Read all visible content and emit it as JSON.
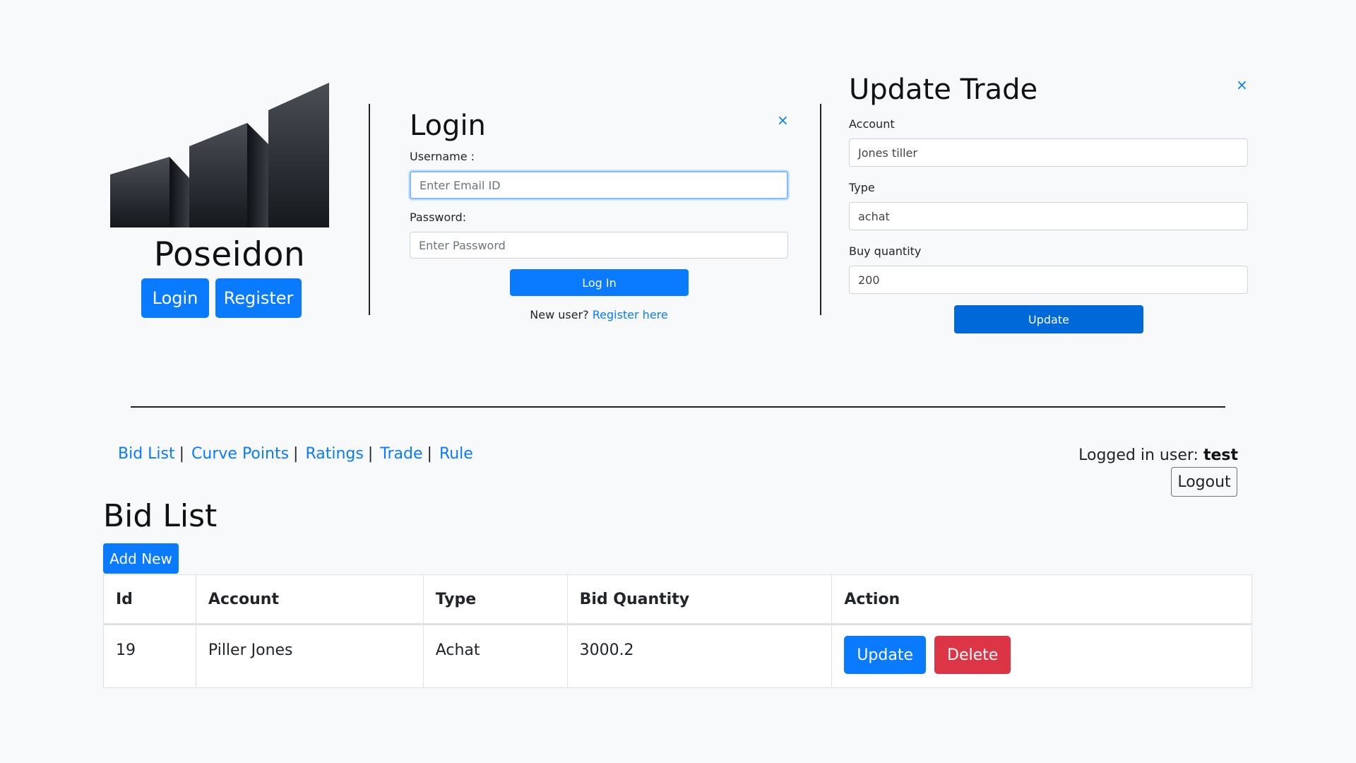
{
  "brand": {
    "name": "Poseidon",
    "login_label": "Login",
    "register_label": "Register"
  },
  "login_form": {
    "title": "Login",
    "close": "×",
    "username_label": "Username :",
    "username_placeholder": "Enter Email ID",
    "password_label": "Password:",
    "password_placeholder": "Enter Password",
    "submit_label": "Log In",
    "new_user_text": "New user?",
    "register_link": "Register here"
  },
  "update_trade": {
    "title": "Update Trade",
    "close": "×",
    "account_label": "Account",
    "account_value": "Jones tiller",
    "type_label": "Type",
    "type_value": "achat",
    "quantity_label": "Buy quantity",
    "quantity_value": "200",
    "update_label": "Update"
  },
  "nav": {
    "items": [
      {
        "label": "Bid List"
      },
      {
        "label": "Curve Points"
      },
      {
        "label": "Ratings"
      },
      {
        "label": "Trade"
      },
      {
        "label": "Rule"
      }
    ],
    "separator": "|",
    "logged_in_prefix": "Logged in user:",
    "logged_in_user": "test",
    "logout_label": "Logout"
  },
  "bid_list": {
    "title": "Bid List",
    "add_new_label": "Add New",
    "columns": [
      "Id",
      "Account",
      "Type",
      "Bid Quantity",
      "Action"
    ],
    "rows": [
      {
        "id": "19",
        "account": "Piller Jones",
        "type": "Achat",
        "bid_quantity": "3000.2",
        "update_label": "Update",
        "delete_label": "Delete"
      }
    ]
  },
  "colors": {
    "primary": "#0a7bff",
    "danger": "#dc3545",
    "background": "#f8f9fa"
  }
}
